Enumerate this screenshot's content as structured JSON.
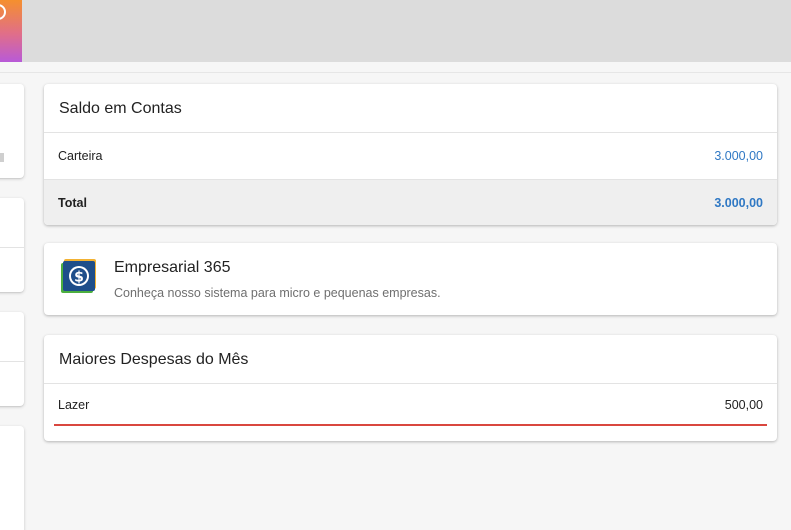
{
  "header": {
    "logo_icon": "app-logo-icon"
  },
  "saldo_card": {
    "title": "Saldo em Contas",
    "accounts": [
      {
        "name": "Carteira",
        "value": "3.000,00"
      }
    ],
    "total_label": "Total",
    "total_value": "3.000,00",
    "value_color": "#2f78c4"
  },
  "promo_card": {
    "icon": "dollar-coin-icon",
    "title": "Empresarial 365",
    "description": "Conheça nosso sistema para micro e pequenas empresas."
  },
  "despesas_card": {
    "title": "Maiores Despesas do Mês",
    "items": [
      {
        "category": "Lazer",
        "value": "500,00",
        "share": 1.0,
        "bar_color": "#d9473f"
      }
    ]
  }
}
